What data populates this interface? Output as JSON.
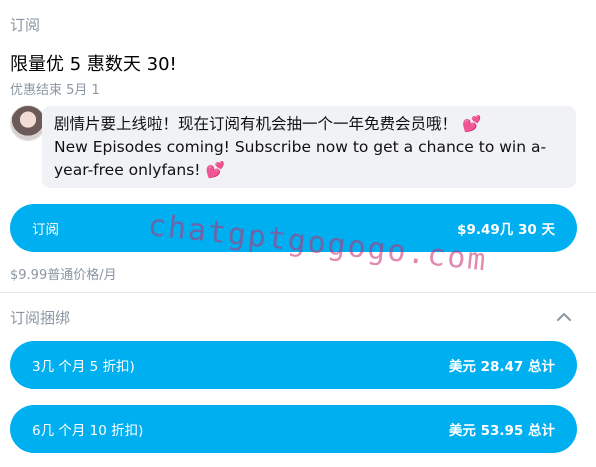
{
  "subscribe_section": {
    "label": "订阅",
    "promo_title": "限量优 5 惠数天 30!",
    "promo_ends": "优惠结束 5月 1"
  },
  "message": {
    "line_cn": "剧情片要上线啦！现在订阅有机会抽一个一年免费会员哦！",
    "line_en": "New Episodes coming! Subscribe now to get a chance to win a-year-free onlyfans!",
    "emoji": "💕"
  },
  "subscribe_button": {
    "label": "订阅",
    "price": "$9.49几 30 天"
  },
  "regular_price": "$9.99普通价格/月",
  "bundles": {
    "label": "订阅捆绑",
    "items": [
      {
        "label": "3几 个月 5 折扣)",
        "price": "美元 28.47 总计"
      },
      {
        "label": "6几 个月 10 折扣)",
        "price": "美元 53.95 总计"
      }
    ]
  },
  "watermark": "chatgptgogogo.com",
  "colors": {
    "accent": "#00aff0",
    "muted": "#8a96a3",
    "message_bg": "#f0f2f5"
  }
}
